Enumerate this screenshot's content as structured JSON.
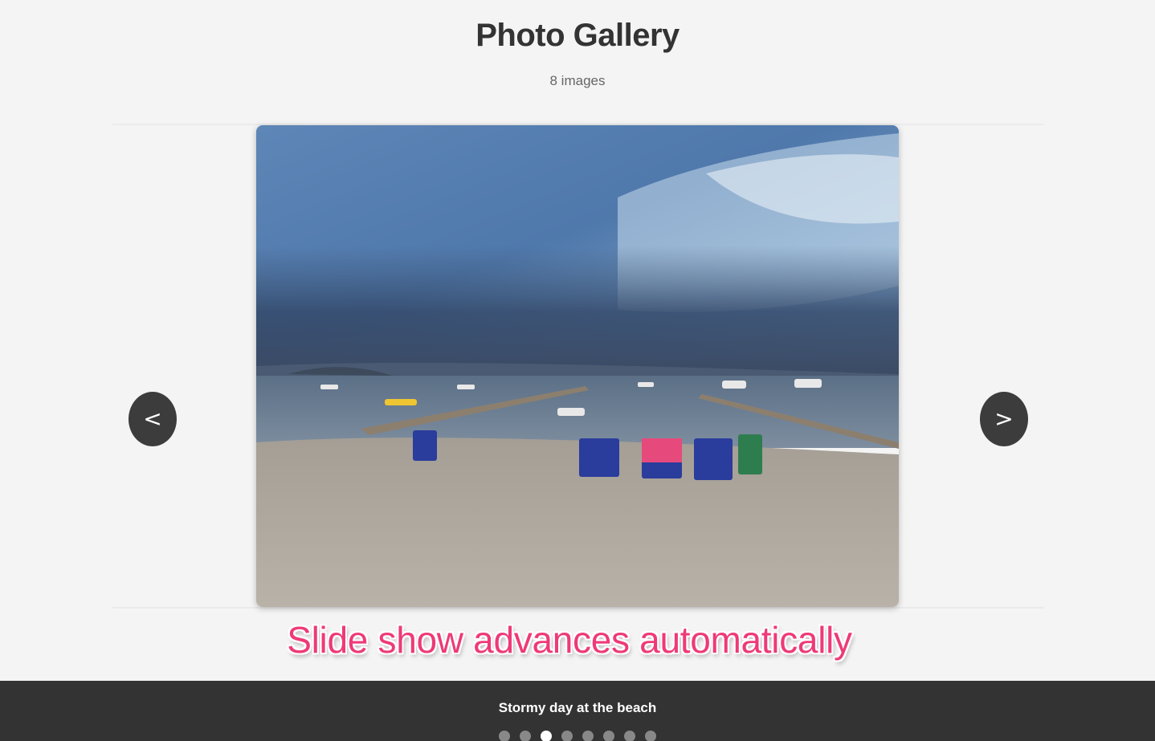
{
  "header": {
    "title": "Photo Gallery",
    "image_count": "8 images"
  },
  "slideshow": {
    "prev_label": "<",
    "next_label": ">",
    "current_index": 2,
    "total": 8,
    "caption": "Stormy day at the beach",
    "note": "Slide show advances automatically"
  },
  "colors": {
    "background": "#f4f4f4",
    "footer": "#333333",
    "nav_button": "#3c3c3c",
    "note_text": "#ee3a78",
    "dot_active": "#ffffff",
    "dot_inactive": "#888888"
  },
  "icons": {
    "prev": "chevron-left-icon",
    "next": "chevron-right-icon"
  }
}
